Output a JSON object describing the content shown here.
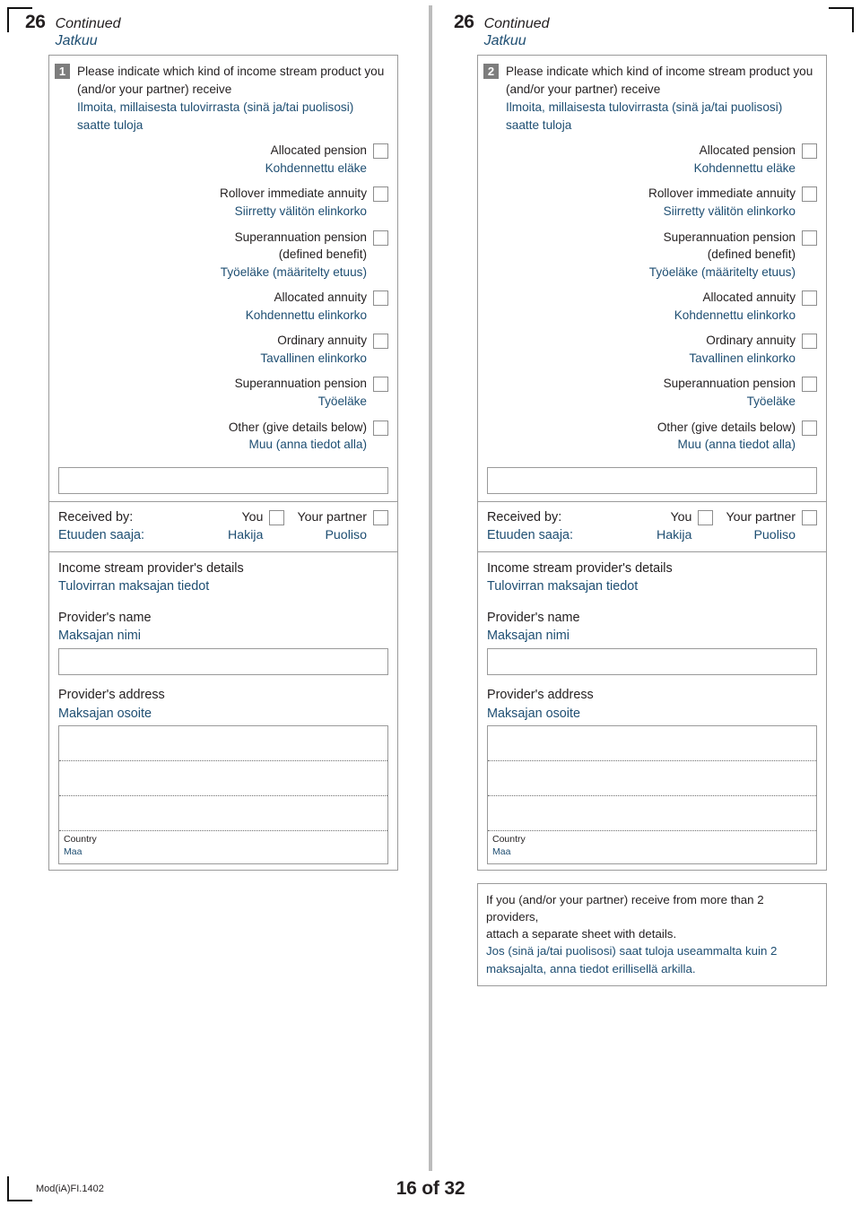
{
  "page": {
    "section_number": "26",
    "continued_en": "Continued",
    "continued_fi": "Jatkuu",
    "footer_code": "Mod(iA)FI.1402",
    "footer_page": "16 of 32",
    "accent_blue": "#1e4e72",
    "ink": "#231f20",
    "badge_gray": "#7d7d7d",
    "border_gray": "#9a9a9a"
  },
  "question": {
    "prompt_en": "Please indicate which kind of income stream product you (and/or your partner) receive",
    "prompt_fi": "Ilmoita, millaisesta tulovirrasta (sinä ja/tai puolisosi) saatte tuloja",
    "options": [
      {
        "en": "Allocated pension",
        "fi": "Kohdennettu eläke"
      },
      {
        "en": "Rollover immediate annuity",
        "fi": "Siirretty välitön elinkorko"
      },
      {
        "en": "Superannuation pension\n(defined benefit)",
        "en_line1": "Superannuation pension",
        "en_line2": "(defined benefit)",
        "fi": "Työeläke (määritelty etuus)"
      },
      {
        "en": "Allocated annuity",
        "fi": "Kohdennettu elinkorko"
      },
      {
        "en": "Ordinary annuity",
        "fi": "Tavallinen elinkorko"
      },
      {
        "en": "Superannuation pension",
        "fi": "Työeläke"
      },
      {
        "en": "Other (give details below)",
        "fi": "Muu (anna tiedot alla)"
      }
    ],
    "other_value": "",
    "received_by_en": "Received by:",
    "received_by_fi": "Etuuden saaja:",
    "you_en": "You",
    "you_fi": "Hakija",
    "partner_en": "Your partner",
    "partner_fi": "Puoliso",
    "provider_details_en": "Income stream provider's details",
    "provider_details_fi": "Tulovirran maksajan tiedot",
    "provider_name_en": "Provider's name",
    "provider_name_fi": "Maksajan nimi",
    "provider_name_value": "",
    "provider_address_en": "Provider's address",
    "provider_address_fi": "Maksajan osoite",
    "address_line_1": "",
    "address_line_2": "",
    "address_line_3": "",
    "country_en": "Country",
    "country_fi": "Maa",
    "country_value": ""
  },
  "columns": {
    "left_number": "1",
    "right_number": "2"
  },
  "note": {
    "en_line1": "If you (and/or your partner) receive from more than 2 providers,",
    "en_line2": "attach a separate sheet with details.",
    "fi_line1": "Jos (sinä ja/tai puolisosi) saat tuloja useammalta kuin 2",
    "fi_line2": "maksajalta, anna tiedot erillisellä arkilla."
  }
}
